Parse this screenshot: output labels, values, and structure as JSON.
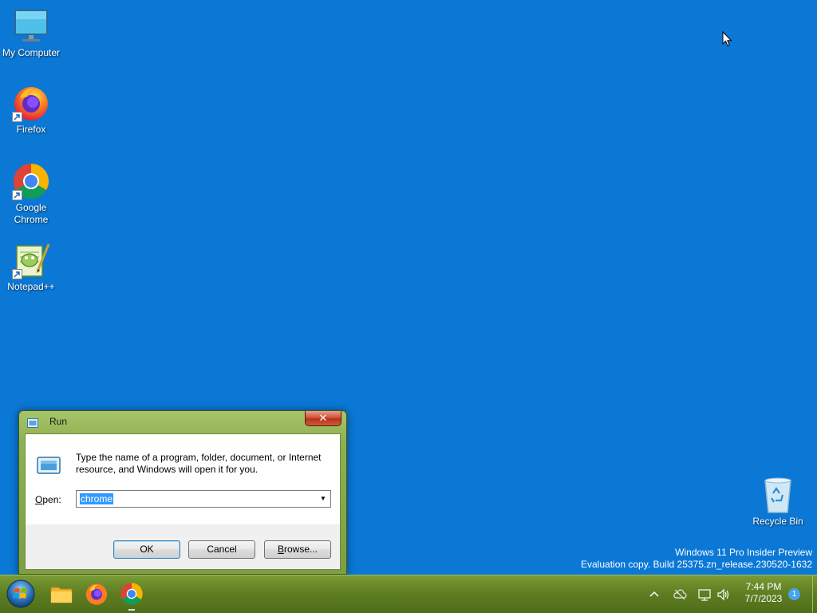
{
  "desktop": {
    "background_color": "#0b78d6",
    "icons": [
      {
        "label": "My Computer",
        "icon": "monitor-icon"
      },
      {
        "label": "Firefox",
        "icon": "firefox-icon"
      },
      {
        "label": "Google Chrome",
        "icon": "chrome-icon"
      },
      {
        "label": "Notepad++",
        "icon": "notepadpp-icon"
      },
      {
        "label": "Recycle Bin",
        "icon": "recycle-bin-icon"
      }
    ],
    "watermark": {
      "line1": "Windows 11 Pro Insider Preview",
      "line2": "Evaluation copy. Build 25375.zn_release.230520-1632"
    }
  },
  "run_dialog": {
    "title": "Run",
    "close_label": "✕",
    "description": "Type the name of a program, folder, document, or Internet resource, and Windows will open it for you.",
    "open_label": "Open:",
    "open_value": "chrome",
    "ok_label": "OK",
    "cancel_label": "Cancel",
    "browse_label": "Browse..."
  },
  "taskbar": {
    "apps": [
      "start-orb",
      "file-explorer-icon",
      "firefox-icon",
      "chrome-icon"
    ],
    "clock_time": "7:44 PM",
    "clock_date": "7/7/2023",
    "notification_count": "1"
  }
}
